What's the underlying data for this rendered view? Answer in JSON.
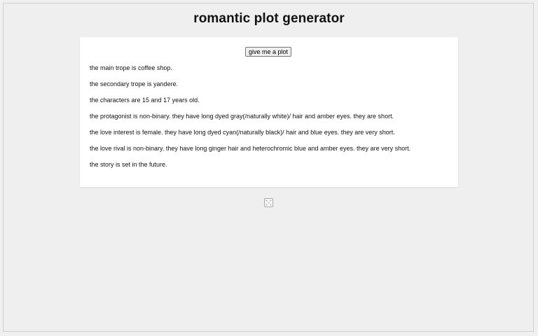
{
  "page": {
    "title": "romantic plot generator"
  },
  "controls": {
    "generate_label": "give me a plot"
  },
  "plot": {
    "lines": [
      "the main trope is coffee shop.",
      "the secondary trope is yandere.",
      "the characters are 15 and 17 years old.",
      "the protagonist is non-binary. they have long dyed gray(/naturally white)/ hair and amber eyes. they are short.",
      "the love interest is female. they have long dyed cyan(/naturally black)/ hair and blue eyes. they are very short.",
      "the love rival is non-binary. they have long ginger hair and heterochromic blue and amber eyes. they are very short.",
      "the story is set in the future."
    ]
  },
  "icons": {
    "footer_icon": "dice-icon"
  }
}
